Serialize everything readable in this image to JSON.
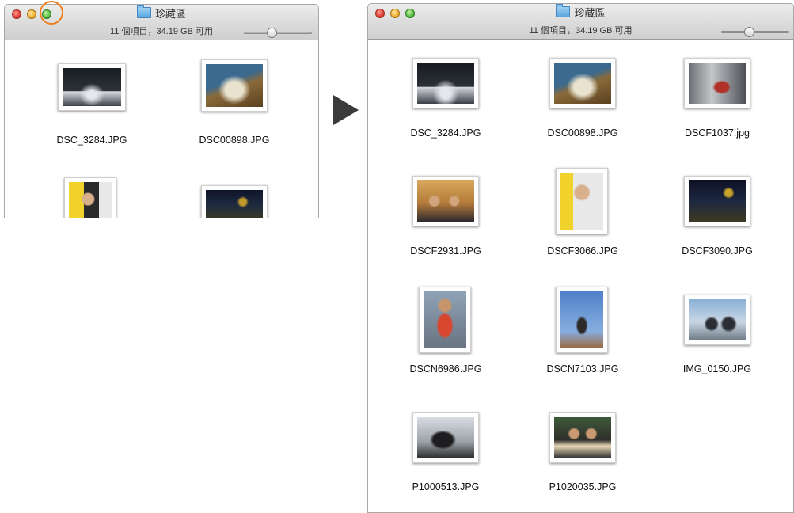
{
  "small_window": {
    "title": "珍藏區",
    "status": "11 個項目，34.19 GB 可用",
    "zoom_level": 0.4,
    "files": [
      "DSC_3284.JPG",
      "DSC00898.JPG"
    ]
  },
  "large_window": {
    "title": "珍藏區",
    "status": "11 個項目，34.19 GB 可用",
    "zoom_level": 0.4,
    "files": [
      "DSC_3284.JPG",
      "DSC00898.JPG",
      "DSCF1037.jpg",
      "DSCF2931.JPG",
      "DSCF3066.JPG",
      "DSCF3090.JPG",
      "DSCN6986.JPG",
      "DSCN7103.JPG",
      "IMG_0150.JPG",
      "P1000513.JPG",
      "P1020035.JPG"
    ]
  },
  "colors": {
    "highlight": "#f07e1b",
    "arrow": "#3b3b3b",
    "close": "#e0463c",
    "minimize": "#f3b43a",
    "zoom": "#5fc24a"
  },
  "icons": {
    "folder": "folder-icon",
    "arrow": "right-triangle-arrow",
    "highlight": "zoom-button-highlight-circle"
  }
}
